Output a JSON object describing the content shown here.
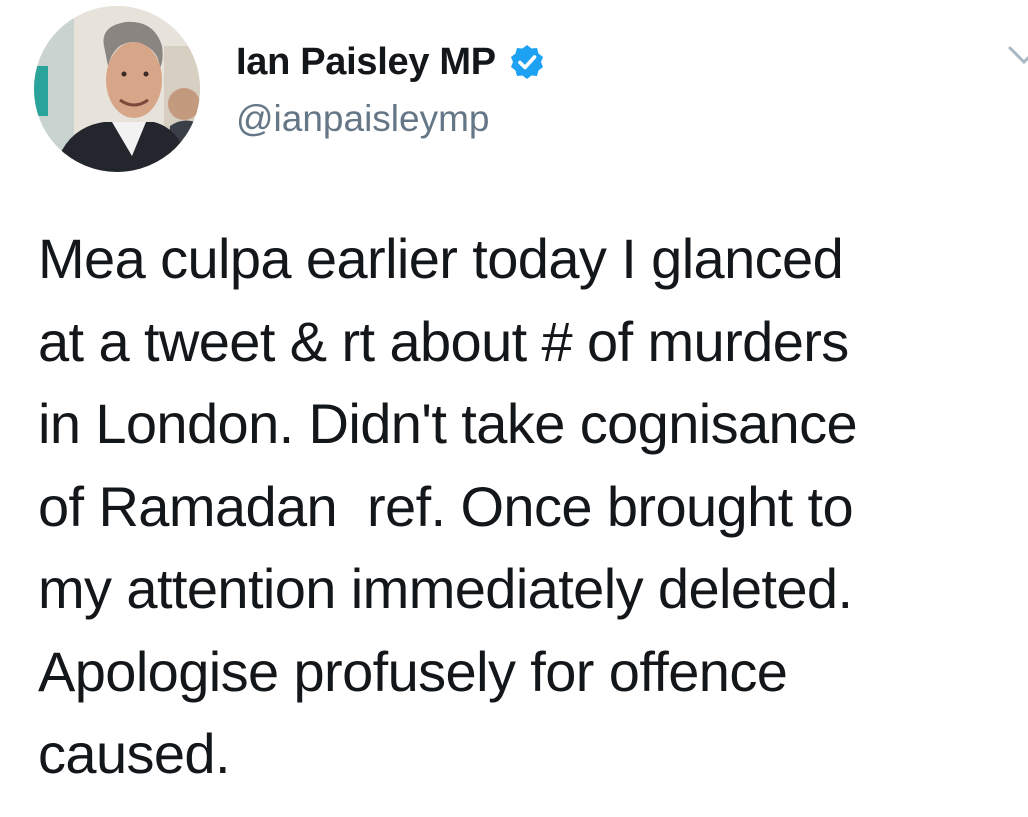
{
  "tweet": {
    "author": {
      "display_name": "Ian Paisley MP",
      "handle": "@ianpaisleymp",
      "verified": true,
      "avatar_icon": "profile-photo"
    },
    "text_lines": [
      "Mea culpa earlier today I glanced",
      "at a tweet & rt about # of murders",
      "in London. Didn't take cognisance",
      "of Ramadan  ref. Once brought to",
      "my attention immediately deleted.",
      "Apologise profusely for offence",
      "caused."
    ],
    "menu_icon": "chevron-down-icon"
  },
  "colors": {
    "text": "#14171a",
    "handle": "#657786",
    "verified_badge": "#1da1f2",
    "chevron": "#aab8c2"
  }
}
